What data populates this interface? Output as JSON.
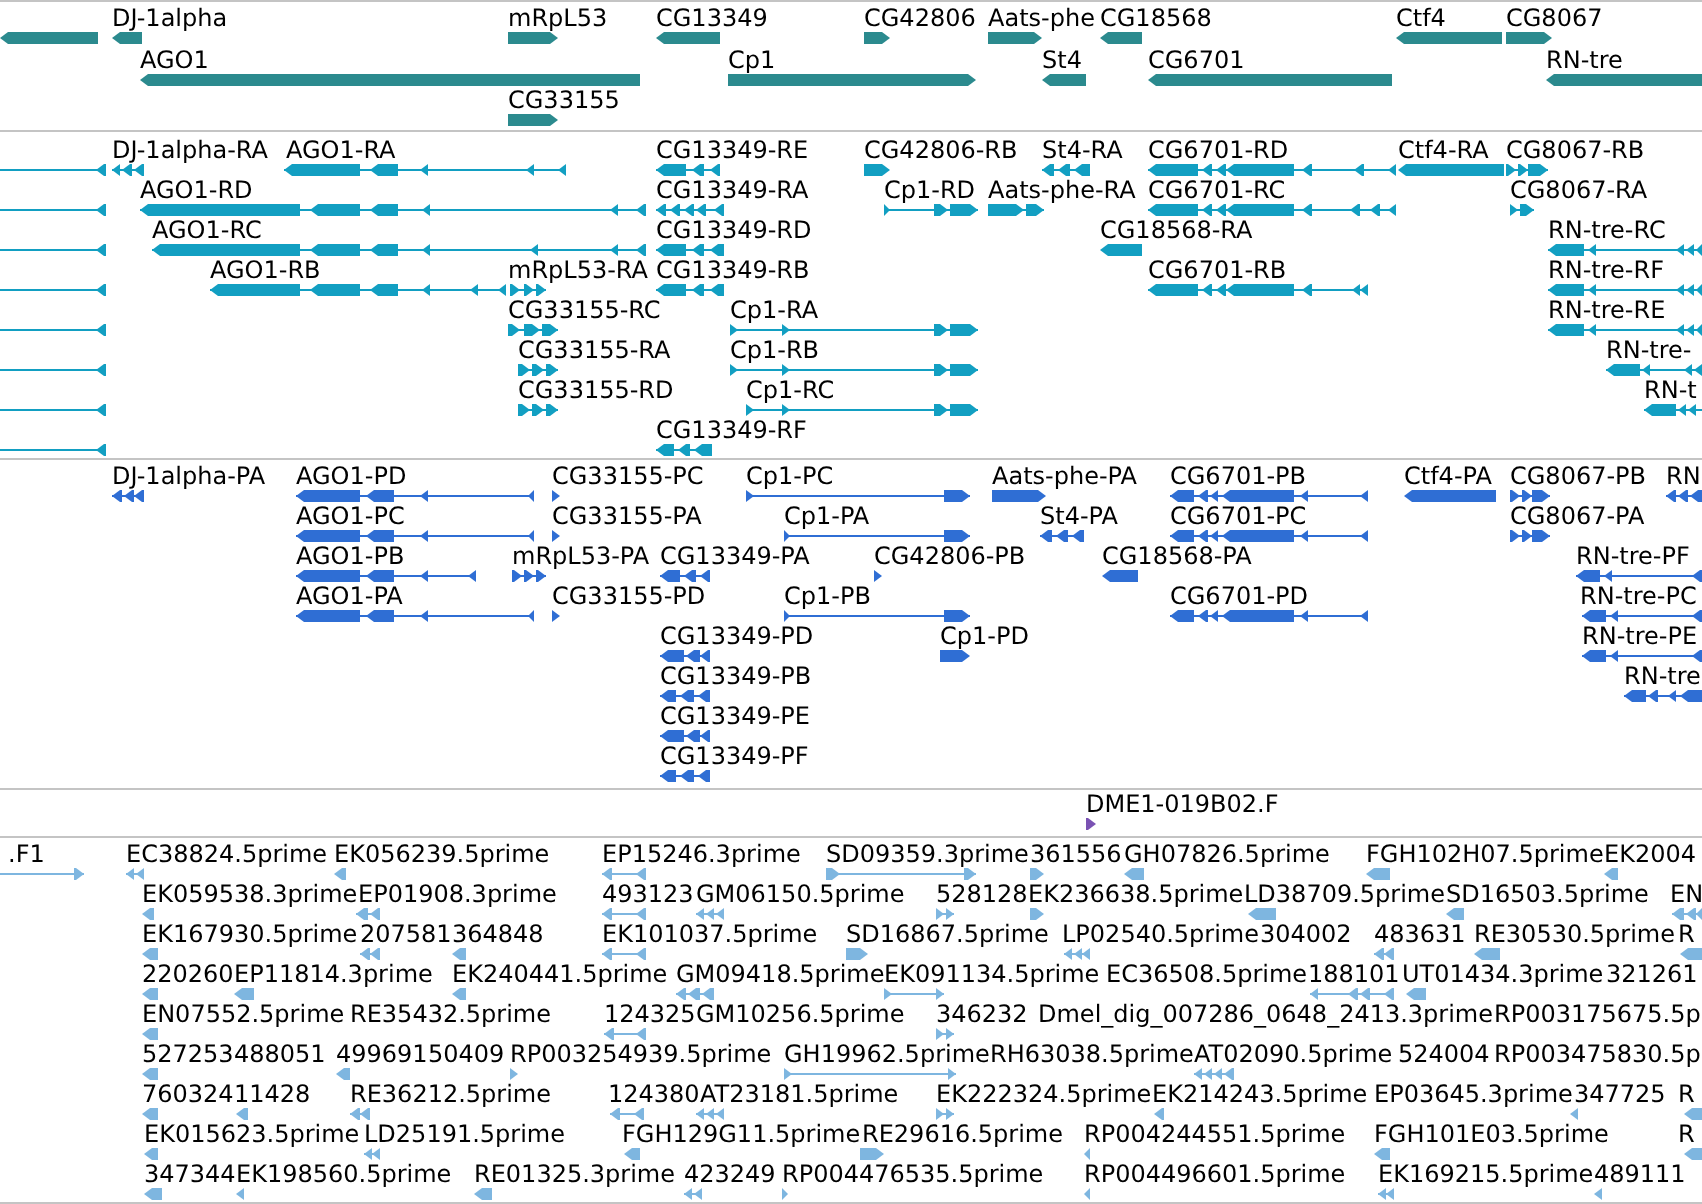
{
  "tracks": [
    {
      "color": "#2b8a8e",
      "rows": [
        {
          "features": [
            {
              "reverse": true
            },
            {
              "label": "DJ-1alpha",
              "reverse": true
            },
            {
              "label": "mRpL53",
              "reverse": false
            },
            {
              "label": "CG13349",
              "reverse": true
            },
            {
              "label": "CG42806",
              "reverse": false
            },
            {
              "label": "Aats-phe",
              "reverse": false
            },
            {
              "label": "CG18568",
              "reverse": true
            },
            {
              "label": "Ctf4",
              "reverse": true
            },
            {
              "label": "CG8067",
              "reverse": false
            }
          ]
        },
        {
          "features": [
            {
              "label": "AGO1",
              "reverse": true
            },
            {
              "label": "Cp1",
              "reverse": false
            },
            {
              "label": "St4",
              "reverse": true
            },
            {
              "label": "CG6701",
              "reverse": true
            },
            {
              "label": "RN-tre",
              "reverse": true
            }
          ]
        },
        {
          "features": [
            {
              "label": "CG33155",
              "reverse": false
            }
          ]
        }
      ]
    },
    {
      "color": "#129fc2",
      "rows": [
        {
          "features": [
            {
              "reverse": true
            },
            {
              "label": "DJ-1alpha-RA",
              "reverse": true
            },
            {
              "label": "AGO1-RA",
              "reverse": true
            },
            {
              "label": "CG13349-RE",
              "reverse": true
            },
            {
              "label": "CG42806-RB",
              "reverse": false
            },
            {
              "label": "St4-RA",
              "reverse": true
            },
            {
              "label": "CG6701-RD",
              "reverse": true
            },
            {
              "label": "Ctf4-RA",
              "reverse": true
            },
            {
              "label": "CG8067-RB",
              "reverse": false
            }
          ]
        },
        {
          "features": [
            {
              "reverse": true
            },
            {
              "label": "AGO1-RD",
              "reverse": true
            },
            {
              "label": "CG13349-RA",
              "reverse": true
            },
            {
              "label": "Cp1-RD",
              "reverse": false
            },
            {
              "label": "Aats-phe-RA",
              "reverse": false
            },
            {
              "label": "CG6701-RC",
              "reverse": true
            },
            {
              "label": "CG8067-RA",
              "reverse": false
            }
          ]
        },
        {
          "features": [
            {
              "reverse": true
            },
            {
              "label": "AGO1-RC",
              "reverse": true
            },
            {
              "label": "CG13349-RD",
              "reverse": true
            },
            {
              "label": "CG18568-RA",
              "reverse": true
            },
            {
              "label": "RN-tre-RC",
              "reverse": true
            }
          ]
        },
        {
          "features": [
            {
              "reverse": true
            },
            {
              "label": "AGO1-RB",
              "reverse": true
            },
            {
              "label": "mRpL53-RA",
              "reverse": false
            },
            {
              "label": "CG13349-RB",
              "reverse": true
            },
            {
              "label": "CG6701-RB",
              "reverse": true
            },
            {
              "label": "RN-tre-RF",
              "reverse": true
            }
          ]
        },
        {
          "features": [
            {
              "reverse": true
            },
            {
              "label": "CG33155-RC",
              "reverse": false
            },
            {
              "label": "Cp1-RA",
              "reverse": false
            },
            {
              "label": "RN-tre-RE",
              "reverse": true
            }
          ]
        },
        {
          "features": [
            {
              "reverse": true
            },
            {
              "label": "CG33155-RA",
              "reverse": false
            },
            {
              "label": "Cp1-RB",
              "reverse": false
            },
            {
              "label": "RN-tre-",
              "reverse": true
            }
          ]
        },
        {
          "features": [
            {
              "reverse": true
            },
            {
              "label": "CG33155-RD",
              "reverse": false
            },
            {
              "label": "Cp1-RC",
              "reverse": false
            },
            {
              "label": "RN-t",
              "reverse": true
            }
          ]
        },
        {
          "features": [
            {
              "reverse": true
            },
            {
              "label": "CG13349-RF",
              "reverse": true
            }
          ]
        }
      ]
    },
    {
      "color": "#2f6ed4",
      "rows": [
        {
          "features": [
            {
              "label": "DJ-1alpha-PA",
              "reverse": true
            },
            {
              "label": "AGO1-PD",
              "reverse": true
            },
            {
              "label": "CG33155-PC",
              "reverse": false
            },
            {
              "label": "Cp1-PC",
              "reverse": false
            },
            {
              "label": "Aats-phe-PA",
              "reverse": false
            },
            {
              "label": "CG6701-PB",
              "reverse": true
            },
            {
              "label": "Ctf4-PA",
              "reverse": true
            },
            {
              "label": "CG8067-PB",
              "reverse": false
            },
            {
              "label": "RN",
              "reverse": true
            }
          ]
        },
        {
          "features": [
            {
              "label": "AGO1-PC",
              "reverse": true
            },
            {
              "label": "CG33155-PA",
              "reverse": false
            },
            {
              "label": "Cp1-PA",
              "reverse": false
            },
            {
              "label": "St4-PA",
              "reverse": true
            },
            {
              "label": "CG6701-PC",
              "reverse": true
            },
            {
              "label": "CG8067-PA",
              "reverse": false
            }
          ]
        },
        {
          "features": [
            {
              "label": "AGO1-PB",
              "reverse": true
            },
            {
              "label": "mRpL53-PA",
              "reverse": false
            },
            {
              "label": "CG13349-PA",
              "reverse": true
            },
            {
              "label": "CG42806-PB",
              "reverse": false
            },
            {
              "label": "CG18568-PA",
              "reverse": true
            },
            {
              "label": "RN-tre-PF",
              "reverse": true
            }
          ]
        },
        {
          "features": [
            {
              "label": "AGO1-PA",
              "reverse": true
            },
            {
              "label": "CG33155-PD",
              "reverse": false
            },
            {
              "label": "Cp1-PB",
              "reverse": false
            },
            {
              "label": "CG6701-PD",
              "reverse": true
            },
            {
              "label": "RN-tre-PC",
              "reverse": true
            }
          ]
        },
        {
          "features": [
            {
              "label": "CG13349-PD",
              "reverse": true
            },
            {
              "label": "Cp1-PD",
              "reverse": false
            },
            {
              "label": "RN-tre-PE",
              "reverse": true
            }
          ]
        },
        {
          "features": [
            {
              "label": "CG13349-PB",
              "reverse": true
            },
            {
              "label": "RN-tre",
              "reverse": true
            }
          ]
        },
        {
          "features": [
            {
              "label": "CG13349-PE",
              "reverse": true
            }
          ]
        },
        {
          "features": [
            {
              "label": "CG13349-PF",
              "reverse": true
            }
          ]
        }
      ]
    },
    {
      "color": "#7a52b3",
      "rows": [
        {
          "features": [
            {
              "label": "DME1-019B02.F",
              "reverse": false
            }
          ]
        }
      ]
    },
    {
      "color": "#7eb6e0",
      "rows": [
        {
          "features": [
            {
              "label": ".F1",
              "reverse": false
            },
            {
              "label": "EC38824.5prime",
              "reverse": true
            },
            {
              "label": "EK056239.5prime",
              "reverse": true
            },
            {
              "label": "EP15246.3prime",
              "reverse": true
            },
            {
              "label": "SD09359.3prime",
              "reverse": false
            },
            {
              "label": "361556",
              "reverse": false
            },
            {
              "label": "GH07826.5prime",
              "reverse": true
            },
            {
              "label": "FGH102H07.5prime",
              "reverse": true
            },
            {
              "label": "EK2004",
              "reverse": true
            }
          ]
        },
        {
          "features": [
            {
              "label": "EK059538.3prime",
              "reverse": true
            },
            {
              "label": "EP01908.3prime",
              "reverse": true
            },
            {
              "label": "493123",
              "reverse": true
            },
            {
              "label": "GM06150.5prime",
              "reverse": true
            },
            {
              "label": "528128",
              "reverse": false
            },
            {
              "label": "EK236638.5prime",
              "reverse": false
            },
            {
              "label": "LD38709.5prime",
              "reverse": true
            },
            {
              "label": "SD16503.5prime",
              "reverse": true
            },
            {
              "label": "EN",
              "reverse": true
            }
          ]
        },
        {
          "features": [
            {
              "label": "EK167930.5prime",
              "reverse": true
            },
            {
              "label": "207581",
              "reverse": true
            },
            {
              "label": "364848",
              "reverse": true
            },
            {
              "label": "EK101037.5prime",
              "reverse": true
            },
            {
              "label": "SD16867.5prime",
              "reverse": false
            },
            {
              "label": "LP02540.5prime",
              "reverse": true
            },
            {
              "label": "304002"
            },
            {
              "label": "483631",
              "reverse": true
            },
            {
              "label": "RE30530.5prime",
              "reverse": true
            },
            {
              "label": "R",
              "reverse": true
            }
          ]
        },
        {
          "features": [
            {
              "label": "220260",
              "reverse": true
            },
            {
              "label": "EP11814.3prime",
              "reverse": true
            },
            {
              "label": "EK240441.5prime",
              "reverse": true
            },
            {
              "label": "GM09418.5prime",
              "reverse": true
            },
            {
              "label": "EK091134.5prime",
              "reverse": false
            },
            {
              "label": "EC36508.5prime"
            },
            {
              "label": "188101",
              "reverse": true
            },
            {
              "label": "UT01434.3prime",
              "reverse": true
            },
            {
              "label": "321261"
            }
          ]
        },
        {
          "features": [
            {
              "label": "EN07552.5prime",
              "reverse": true
            },
            {
              "label": "RE35432.5prime"
            },
            {
              "label": "124325",
              "reverse": true
            },
            {
              "label": "GM10256.5prime"
            },
            {
              "label": "346232",
              "reverse": false
            },
            {
              "label": "Dmel_dig_007286_0648_2413.3prime"
            },
            {
              "label": "RP003175675.5p"
            }
          ]
        },
        {
          "features": [
            {
              "label": "527253",
              "reverse": true
            },
            {
              "label": "488051"
            },
            {
              "label": "499691",
              "reverse": true
            },
            {
              "label": "50409"
            },
            {
              "label": "RP003254939.5prime",
              "reverse": false
            },
            {
              "label": "GH19962.5prime",
              "reverse": false
            },
            {
              "label": "RH63038.5prime"
            },
            {
              "label": "AT02090.5prime",
              "reverse": true
            },
            {
              "label": "524004"
            },
            {
              "label": "RP003475830.5p"
            }
          ]
        },
        {
          "features": [
            {
              "label": "760324",
              "reverse": true
            },
            {
              "label": "11428",
              "reverse": true
            },
            {
              "label": "RE36212.5prime",
              "reverse": true
            },
            {
              "label": "124380",
              "reverse": true
            },
            {
              "label": "AT23181.5prime",
              "reverse": true
            },
            {
              "label": "EK222324.5prime",
              "reverse": false
            },
            {
              "label": "EK214243.5prime",
              "reverse": true
            },
            {
              "label": "EP03645.3prime"
            },
            {
              "label": "347725",
              "reverse": true
            },
            {
              "label": "R",
              "reverse": true
            }
          ]
        },
        {
          "features": [
            {
              "label": "EK015623.5prime",
              "reverse": true
            },
            {
              "label": "LD25191.5prime",
              "reverse": true
            },
            {
              "label": "FGH129G11.5prime",
              "reverse": true
            },
            {
              "label": "RE29616.5prime",
              "reverse": false
            },
            {
              "label": "RP004244551.5prime",
              "reverse": true
            },
            {
              "label": "FGH101E03.5prime",
              "reverse": true
            },
            {
              "label": "R",
              "reverse": true
            }
          ]
        },
        {
          "features": [
            {
              "label": "347344",
              "reverse": true
            },
            {
              "label": "EK198560.5prime",
              "reverse": true
            },
            {
              "label": "RE01325.3prime",
              "reverse": true
            },
            {
              "label": "423249",
              "reverse": true
            },
            {
              "label": "RP004476535.5prime",
              "reverse": false
            },
            {
              "label": "RP004496601.5prime",
              "reverse": true
            },
            {
              "label": "EK169215.5prime",
              "reverse": true
            },
            {
              "label": "489111",
              "reverse": true
            }
          ]
        }
      ]
    }
  ]
}
